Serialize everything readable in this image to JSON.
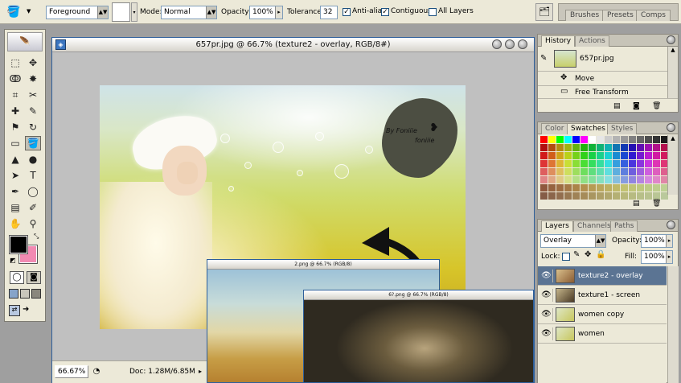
{
  "options_bar": {
    "fill_source": "Foreground",
    "mode_label": "Mode:",
    "mode_value": "Normal",
    "opacity_label": "Opacity:",
    "opacity_value": "100%",
    "tolerance_label": "Tolerance:",
    "tolerance_value": "32",
    "anti_alias_label": "Anti-alias",
    "contiguous_label": "Contiguous",
    "all_layers_label": "All Layers",
    "anti_alias_checked": true,
    "contiguous_checked": true,
    "all_layers_checked": false,
    "palette_well_tabs": [
      "Brushes",
      "Presets",
      "Comps"
    ]
  },
  "toolbox": {
    "tools": [
      "marquee",
      "move",
      "lasso",
      "magic-wand",
      "crop",
      "slice",
      "healing",
      "brush",
      "stamp",
      "history-brush",
      "eraser",
      "paint-bucket",
      "blur",
      "dodge",
      "path-select",
      "type",
      "pen",
      "shape",
      "notes",
      "eyedropper",
      "hand",
      "zoom"
    ],
    "selected_tool": "paint-bucket",
    "foreground_color": "#000000",
    "background_color": "#f28ab2"
  },
  "document": {
    "title": "657pr.jpg @ 66.7% (texture2 - overlay, RGB/8#)",
    "watermark_line1": "By Foniiie",
    "watermark_line2": "foniiie",
    "zoom": "66.67%",
    "doc_size": "Doc: 1.28M/6.85M"
  },
  "float_windows": [
    {
      "title": "2.png @ 66.7% (RGB/8)"
    },
    {
      "title": "6?.png @ 66.7% (RGB/8)"
    }
  ],
  "history_panel": {
    "tabs": [
      "History",
      "Actions"
    ],
    "snapshot": "657pr.jpg",
    "items": [
      "Move",
      "Free Transform"
    ]
  },
  "swatches_panel": {
    "tabs": [
      "Color",
      "Swatches",
      "Styles"
    ]
  },
  "layers_panel": {
    "tabs": [
      "Layers",
      "Channels",
      "Paths"
    ],
    "blend_mode": "Overlay",
    "opacity_label": "Opacity:",
    "opacity_value": "100%",
    "lock_label": "Lock:",
    "fill_label": "Fill:",
    "fill_value": "100%",
    "layers": [
      {
        "name": "texture2 - overlay",
        "selected": true
      },
      {
        "name": "texture1 - screen",
        "selected": false
      },
      {
        "name": "women copy",
        "selected": false
      },
      {
        "name": "women",
        "selected": false
      }
    ]
  },
  "colors": {
    "accent": "#1f4f8f",
    "selected_layer": "#5b7493",
    "chrome": "#ece9d8"
  }
}
